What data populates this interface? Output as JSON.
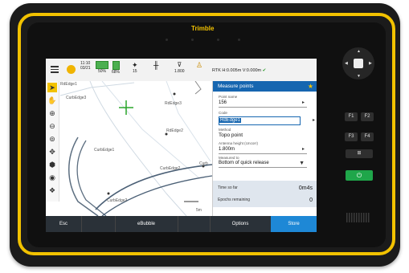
{
  "device": {
    "brand": "Trimble"
  },
  "statusbar": {
    "time": "11:10",
    "date": "03/21",
    "battery_1": "50%",
    "battery_2": "68%",
    "satellites": "15",
    "antenna_height": "1.800",
    "precision": "RTK H:0.005m V:0.000m"
  },
  "map": {
    "labels": [
      "RdEdge1",
      "CurbEdge3",
      "RdEdge3",
      "RdEdge2",
      "CurbEdge1",
      "CurbEdge2",
      "CurbEdge2",
      "Curb"
    ],
    "scale": "5m",
    "tools": [
      "pointer-icon",
      "pan-hand-icon",
      "zoom-in-icon",
      "zoom-out-icon",
      "zoom-extents-icon",
      "orbit-icon",
      "layers-icon",
      "eye-icon",
      "stack-icon"
    ]
  },
  "panel": {
    "title": "Measure points",
    "point_name_label": "Point name",
    "point_name_value": "156",
    "code_label": "Code",
    "code_value": "RdEdge1",
    "method_label": "Method",
    "method_value": "Topo point",
    "antenna_height_label": "Antenna height (Uncorr)",
    "antenna_height_value": "1.800m",
    "measured_to_label": "Measured to",
    "measured_to_value": "Bottom of quick release",
    "time_so_far_label": "Time so far",
    "time_so_far_value": "0m4s",
    "epochs_label": "Epochs remaining",
    "epochs_value": "0"
  },
  "softkeys": {
    "esc": "Esc",
    "ebubble": "eBubble",
    "options": "Options",
    "store": "Store"
  },
  "hardware": {
    "f1": "F1",
    "f2": "F2",
    "f3": "F3",
    "f4": "F4"
  },
  "colors": {
    "accent": "#1666b0",
    "bumper": "#f2c200",
    "power": "#1fa64a"
  }
}
